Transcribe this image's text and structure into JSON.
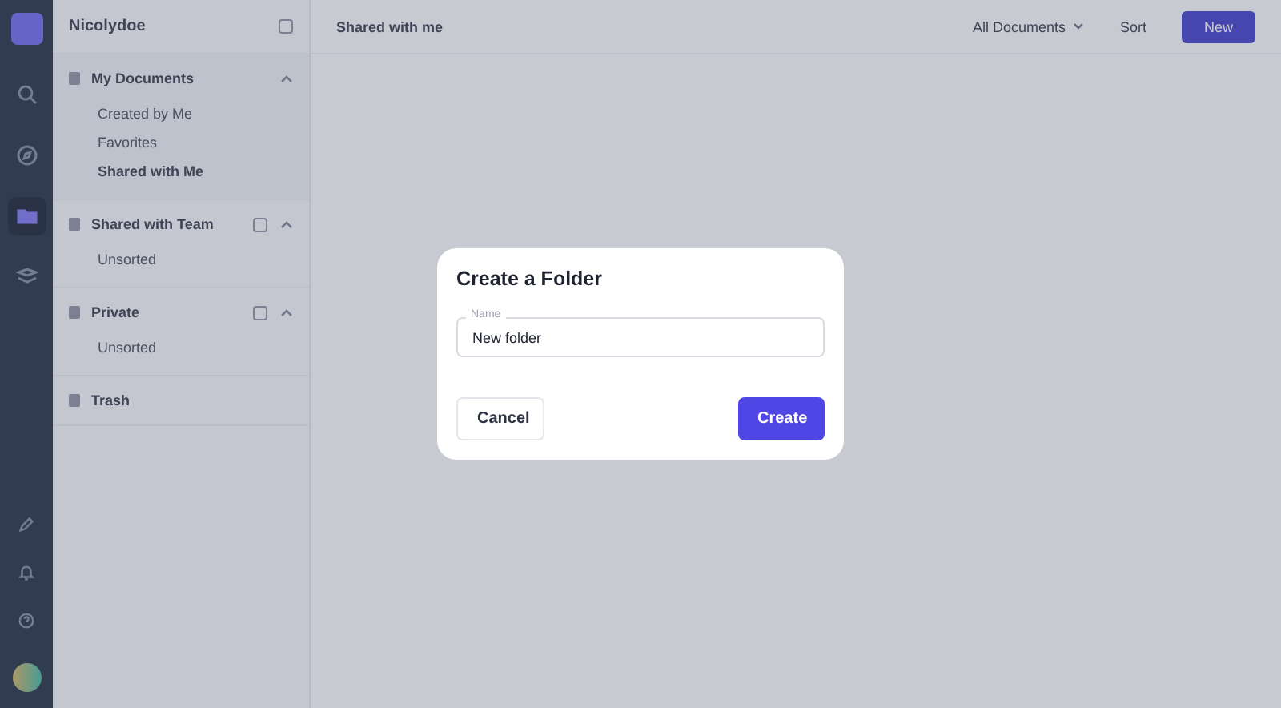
{
  "rail": {
    "top": [
      {
        "kind": "search",
        "selected": false
      },
      {
        "kind": "compass",
        "selected": false
      },
      {
        "kind": "folder",
        "selected": true
      },
      {
        "kind": "layers",
        "selected": false
      }
    ],
    "bottom": [
      {
        "kind": "edit"
      },
      {
        "kind": "bell"
      },
      {
        "kind": "help"
      }
    ]
  },
  "sidebar": {
    "workspace": "Nicolydoe",
    "sections": [
      {
        "label": "My Documents",
        "expanded": true,
        "children": [
          {
            "label": "Created by Me",
            "selected": false
          },
          {
            "label": "Favorites",
            "selected": false
          },
          {
            "label": "Shared with Me",
            "selected": true
          }
        ]
      },
      {
        "label": "Shared with Team",
        "expanded": true,
        "children": [
          {
            "label": "Unsorted",
            "selected": false
          }
        ]
      },
      {
        "label": "Private",
        "expanded": true,
        "children": [
          {
            "label": "Unsorted",
            "selected": false
          }
        ]
      },
      {
        "label": "Trash"
      }
    ]
  },
  "header": {
    "title": "Shared with me",
    "filter": "All Documents",
    "sort": "Sort",
    "new_button": "New"
  },
  "dialog": {
    "title": "Create a Folder",
    "field": {
      "label": "Name",
      "value": "New folder"
    },
    "buttons": [
      {
        "label": "Cancel",
        "kind": "secondary"
      },
      {
        "label": "Create",
        "kind": "primary"
      }
    ]
  }
}
